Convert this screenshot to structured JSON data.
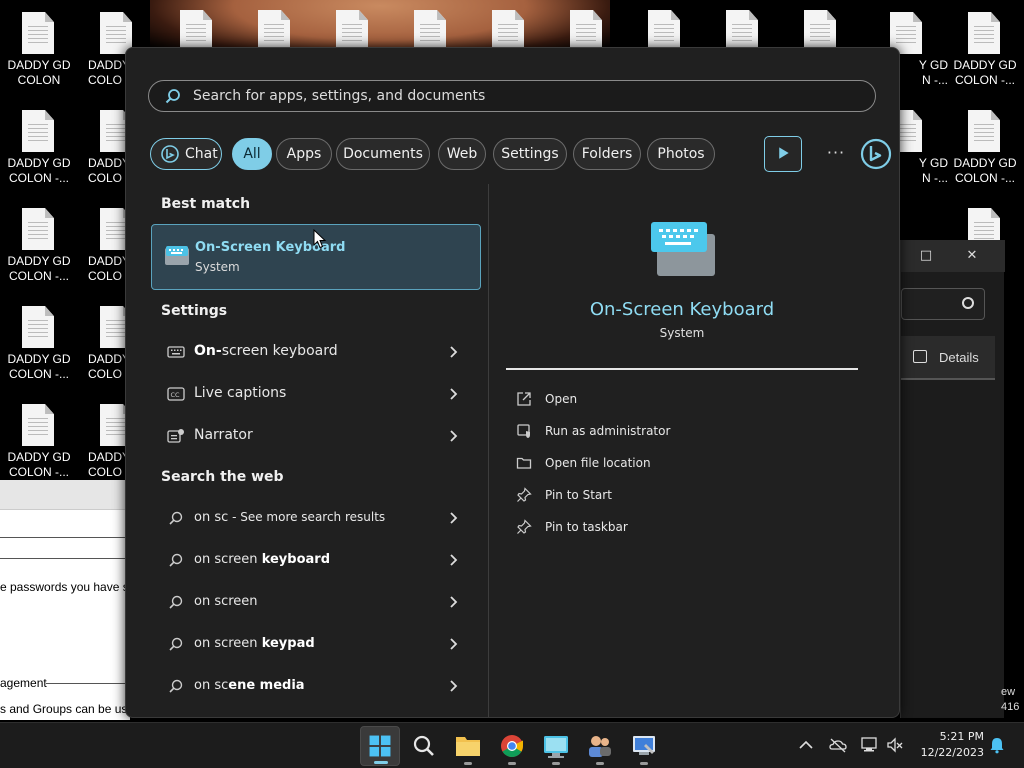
{
  "desktop": {
    "icon_label_line1": "DADDY GD",
    "icons": [
      {
        "line2": "COLON"
      },
      {
        "line2": "COLON -..."
      },
      {
        "line2": "COLON -..."
      },
      {
        "line2": "COLON -..."
      },
      {
        "line2": "COLON -..."
      },
      {
        "line2": "COLON -..."
      },
      {
        "line2": "COLON -..."
      }
    ],
    "partial_col2": "DADDY",
    "partial_col2_line2": "COLO",
    "partial_right": "Y GD",
    "partial_right_line2": "N -..."
  },
  "background_window": {
    "text_passwords": "e passwords you have s",
    "text_management": "agement",
    "text_groups": "s and Groups can be use"
  },
  "right_window": {
    "details_label": "Details",
    "footer_1": "ew",
    "footer_2": "416"
  },
  "search": {
    "placeholder": "Search for apps, settings, and documents"
  },
  "filters": {
    "chat": "Chat",
    "all": "All",
    "apps": "Apps",
    "documents": "Documents",
    "web": "Web",
    "settings": "Settings",
    "folders": "Folders",
    "photos": "Photos",
    "more": "···"
  },
  "best_match": {
    "heading": "Best match",
    "title": "On-Screen Keyboard",
    "subtitle": "System"
  },
  "settings_section": {
    "heading": "Settings",
    "items": [
      {
        "bold": "On-",
        "rest": "screen keyboard"
      },
      {
        "bold": "",
        "rest": "Live captions"
      },
      {
        "bold": "",
        "rest": "Narrator"
      }
    ]
  },
  "web_section": {
    "heading": "Search the web",
    "items": [
      {
        "prefix": "on sc",
        "suffix": " - See more search results"
      },
      {
        "prefix": "on screen ",
        "suffix": "keyboard"
      },
      {
        "prefix": "on screen",
        "suffix": ""
      },
      {
        "prefix": "on screen ",
        "suffix": "keypad"
      },
      {
        "prefix": "on sc",
        "suffix": "ene media"
      }
    ]
  },
  "detail_pane": {
    "title": "On-Screen Keyboard",
    "subtitle": "System",
    "actions": [
      "Open",
      "Run as administrator",
      "Open file location",
      "Pin to Start",
      "Pin to taskbar"
    ]
  },
  "taskbar": {
    "time": "5:21 PM",
    "date": "12/22/2023"
  },
  "colors": {
    "accent": "#7fcde7",
    "panel_bg": "#202020",
    "highlight_bg": "#2f4450"
  }
}
